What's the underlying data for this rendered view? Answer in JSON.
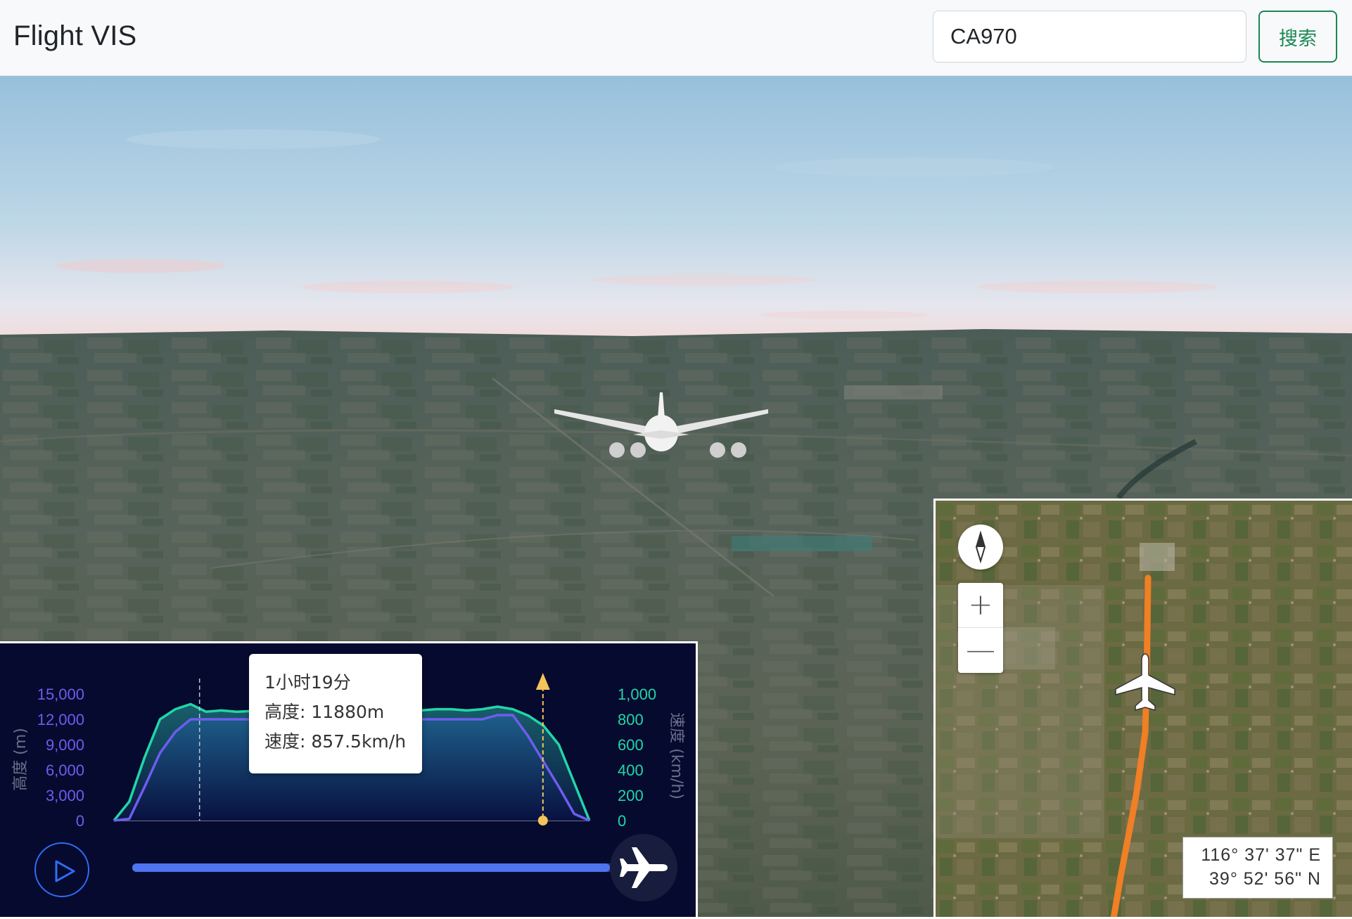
{
  "header": {
    "brand": "Flight VIS",
    "search_value": "CA970",
    "search_button_label": "搜索"
  },
  "chart": {
    "left_axis_label": "高度 (m)",
    "right_axis_label": "速度 (km/h)",
    "tooltip": {
      "time": "1小时19分",
      "altitude": "高度: 11880m",
      "speed": "速度: 857.5km/h"
    },
    "playback_progress": 0.93
  },
  "chart_data": {
    "type": "area",
    "y_left": {
      "label": "高度 (m)",
      "ticks": [
        "0",
        "3,000",
        "6,000",
        "9,000",
        "12,000",
        "15,000"
      ],
      "range": [
        0,
        15000
      ]
    },
    "y_right": {
      "label": "速度 (km/h)",
      "ticks": [
        "0",
        "200",
        "400",
        "600",
        "800",
        "1,000"
      ],
      "range": [
        0,
        1000
      ]
    },
    "series": [
      {
        "name": "高度",
        "color": "#6f5cf0",
        "values": [
          0,
          200,
          4000,
          8000,
          10500,
          12000,
          12000,
          12000,
          12000,
          12000,
          12000,
          12000,
          12000,
          12000,
          12000,
          12000,
          12000,
          12000,
          12000,
          12000,
          12000,
          12000,
          12000,
          12000,
          12000,
          12500,
          12500,
          10000,
          7000,
          4000,
          800,
          0
        ]
      },
      {
        "name": "速度",
        "color": "#21d6a8",
        "values": [
          0,
          150,
          500,
          800,
          880,
          920,
          860,
          870,
          860,
          865,
          870,
          860,
          865,
          870,
          860,
          865,
          870,
          860,
          865,
          870,
          870,
          880,
          880,
          870,
          880,
          900,
          880,
          830,
          750,
          600,
          300,
          0
        ]
      }
    ],
    "cursor_time": "1小时19分",
    "cursor_altitude": "11880m",
    "cursor_speed": "857.5km/h"
  },
  "minimap": {
    "compass_icon": "compass-icon",
    "zoom_in_label": "+",
    "zoom_out_label": "—",
    "coord_lon": "116° 37' 37\" E",
    "coord_lat": "39° 52' 56\" N",
    "track_color": "#f07f25"
  },
  "colors": {
    "panel_bg": "#060a2e",
    "altitude": "#6f5cf0",
    "speed": "#21d6a8",
    "progress": "#4f74f0",
    "accent_green": "#198754"
  }
}
